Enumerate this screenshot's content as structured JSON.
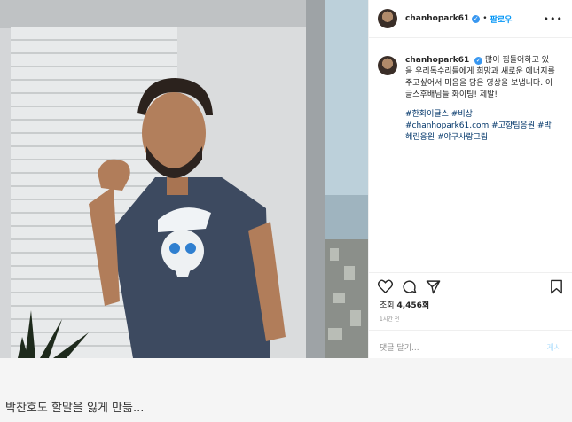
{
  "post": {
    "username": "chanhopark61",
    "verified_icon": "verified-badge-icon",
    "dot": "•",
    "follow_label": "팔로우",
    "more_icon": "•••",
    "caption_user": "chanhopark61",
    "caption_text": "많이 힘들어하고 있을 우리독수리들에게 희망과 새로운 에너지를 주고싶어서 마음을 담은 영상을 보냅니다. 이글스후배님들 화이팅! 제발!",
    "caption_tags": "#한화이글스 #비상 #chanhopark61.com #고향팀응원 #박혜린응원 #야구사랑그림",
    "views_label": "조회",
    "views_count": "4,456회",
    "time": "1시간 전",
    "comment_placeholder": "댓글 달기...",
    "post_label": "게시"
  },
  "article": {
    "caption": "박찬호도 할말을 잃게 만듦..."
  },
  "colors": {
    "accent": "#0095f6",
    "verified": "#3897f0",
    "hashtag": "#003569"
  }
}
